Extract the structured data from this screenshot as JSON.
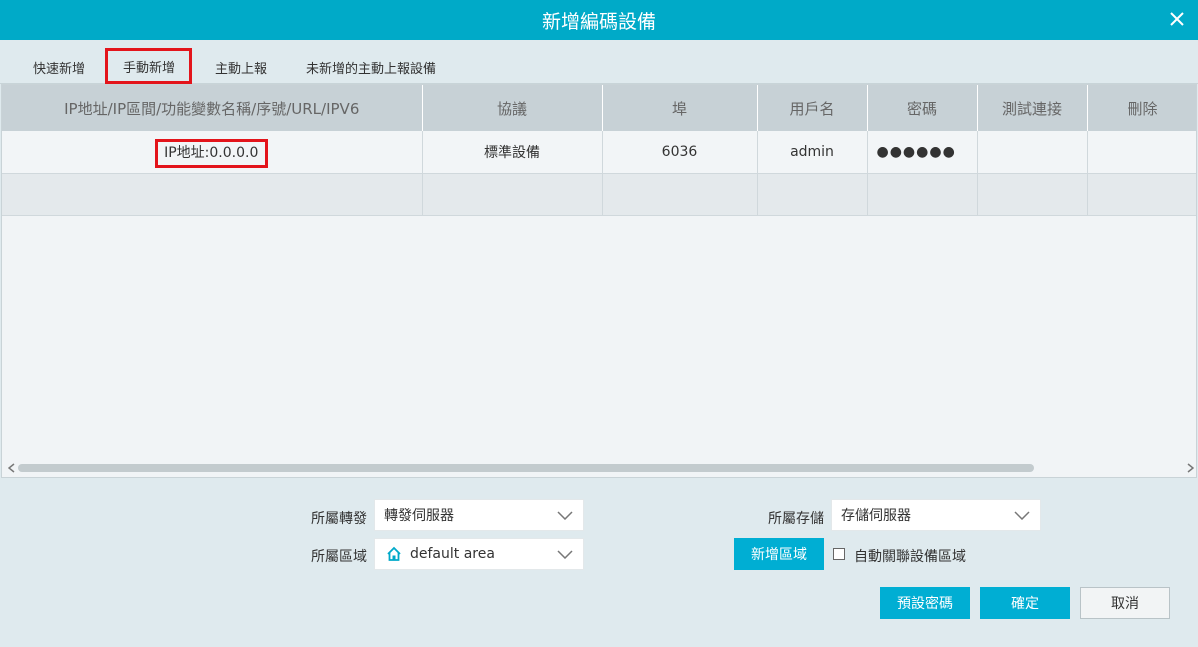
{
  "dialog": {
    "title": "新增編碼設備"
  },
  "tabs": [
    {
      "label": "快速新增"
    },
    {
      "label": "手動新增"
    },
    {
      "label": "主動上報"
    },
    {
      "label": "未新增的主動上報設備"
    }
  ],
  "table": {
    "headers": [
      "IP地址/IP區間/功能變數名稱/序號/URL/IPV6",
      "協議",
      "埠",
      "用戶名",
      "密碼",
      "測試連接",
      "刪除"
    ],
    "rows": [
      {
        "address": "IP地址:0.0.0.0",
        "protocol": "標準設備",
        "port": "6036",
        "username": "admin",
        "password": "●●●●●●",
        "test": "",
        "delete": ""
      }
    ]
  },
  "form": {
    "forward_label": "所屬轉發",
    "forward_value": "轉發伺服器",
    "storage_label": "所屬存儲",
    "storage_value": "存儲伺服器",
    "area_label": "所屬區域",
    "area_value": "default area",
    "add_area_button": "新增區域",
    "auto_link_label": "自動關聯設備區域"
  },
  "footer": {
    "default_password_button": "預設密碼",
    "confirm_button": "確定",
    "cancel_button": "取消"
  },
  "colors": {
    "accent": "#00aac8",
    "highlight": "#e3141b"
  }
}
